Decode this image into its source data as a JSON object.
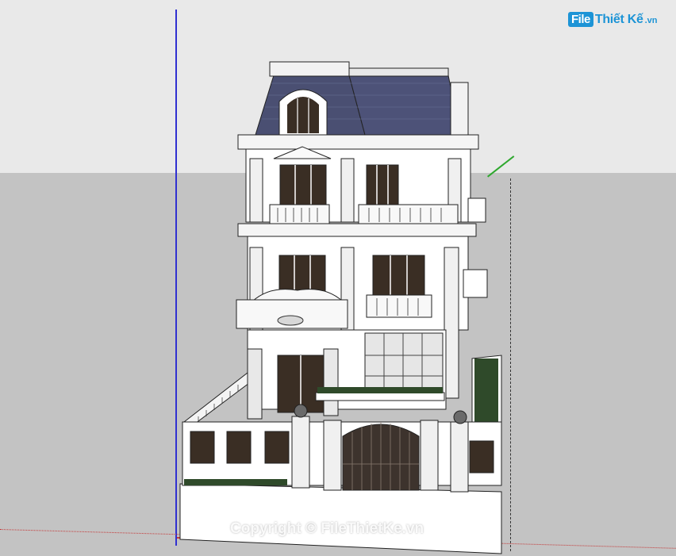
{
  "viewport": {
    "sky_color": "#e9e9e9",
    "ground_color": "#c3c3c3",
    "axis_colors": {
      "blue": "#3030d0",
      "red": "#c43a3a",
      "green": "#2fa82f"
    }
  },
  "watermark_logo": {
    "badge": "File",
    "text": "Thiết Kế",
    "suffix": ".vn",
    "color": "#1d94d6"
  },
  "copyright": "Copyright © FileThietKe.vn",
  "model": {
    "roof_color": "#4a4f72",
    "wall_color": "#ffffff",
    "lawn_color": "#2f4a2a",
    "window_color": "#3a2e24",
    "gate_color": "#3d332d"
  }
}
